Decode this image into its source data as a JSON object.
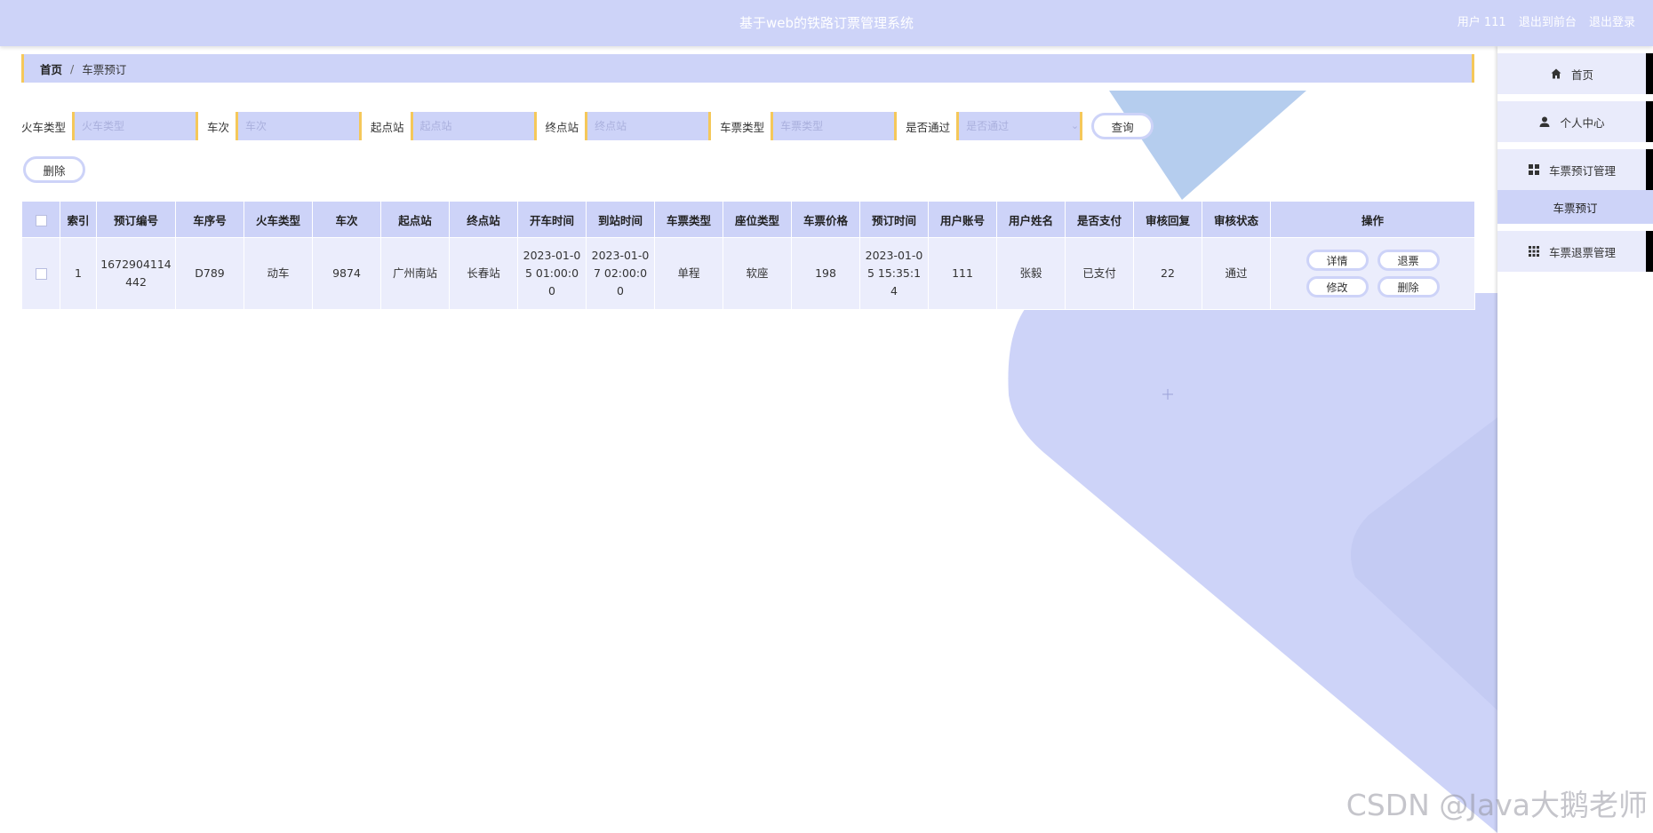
{
  "header": {
    "title": "基于web的铁路订票管理系统",
    "user_label": "用户 111",
    "back_to_front": "退出到前台",
    "logout": "退出登录"
  },
  "breadcrumb": {
    "home": "首页",
    "separator": "/",
    "current": "车票预订"
  },
  "search": {
    "train_type": {
      "label": "火车类型",
      "placeholder": "火车类型"
    },
    "train_no": {
      "label": "车次",
      "placeholder": "车次"
    },
    "start": {
      "label": "起点站",
      "placeholder": "起点站"
    },
    "end": {
      "label": "终点站",
      "placeholder": "终点站"
    },
    "ticket_type": {
      "label": "车票类型",
      "placeholder": "车票类型"
    },
    "passed": {
      "label": "是否通过",
      "placeholder": "是否通过"
    },
    "query_button": "查询"
  },
  "actions": {
    "delete_button": "删除"
  },
  "table": {
    "columns": [
      "索引",
      "预订编号",
      "车序号",
      "火车类型",
      "车次",
      "起点站",
      "终点站",
      "开车时间",
      "到站时间",
      "车票类型",
      "座位类型",
      "车票价格",
      "预订时间",
      "用户账号",
      "用户姓名",
      "是否支付",
      "审核回复",
      "审核状态",
      "操作"
    ],
    "rows": [
      {
        "index": "1",
        "booking_no": "1672904114442",
        "car_no": "D789",
        "train_type": "动车",
        "train_no": "9874",
        "start": "广州南站",
        "end": "长春站",
        "depart": "2023-01-05 01:00:00",
        "arrive": "2023-01-07 02:00:00",
        "ticket_type": "单程",
        "seat_type": "软座",
        "price": "198",
        "book_time": "2023-01-05 15:35:14",
        "account": "111",
        "name": "张毅",
        "paid": "已支付",
        "reply": "22",
        "status": "通过",
        "ops": {
          "detail": "详情",
          "refund": "退票",
          "edit": "修改",
          "delete": "删除"
        }
      }
    ]
  },
  "sidebar": {
    "items": [
      {
        "label": "首页",
        "icon": "home-icon"
      },
      {
        "label": "个人中心",
        "icon": "user-icon"
      },
      {
        "label": "车票预订管理",
        "icon": "grid-icon"
      },
      {
        "label": "车票预订",
        "sub": true
      },
      {
        "label": "车票退票管理",
        "icon": "apps-icon"
      }
    ]
  },
  "watermark": "CSDN @Java大鹅老师",
  "colors": {
    "primary": "#cdd3f8",
    "accent": "#f5c85a",
    "row": "#ebedfc"
  }
}
